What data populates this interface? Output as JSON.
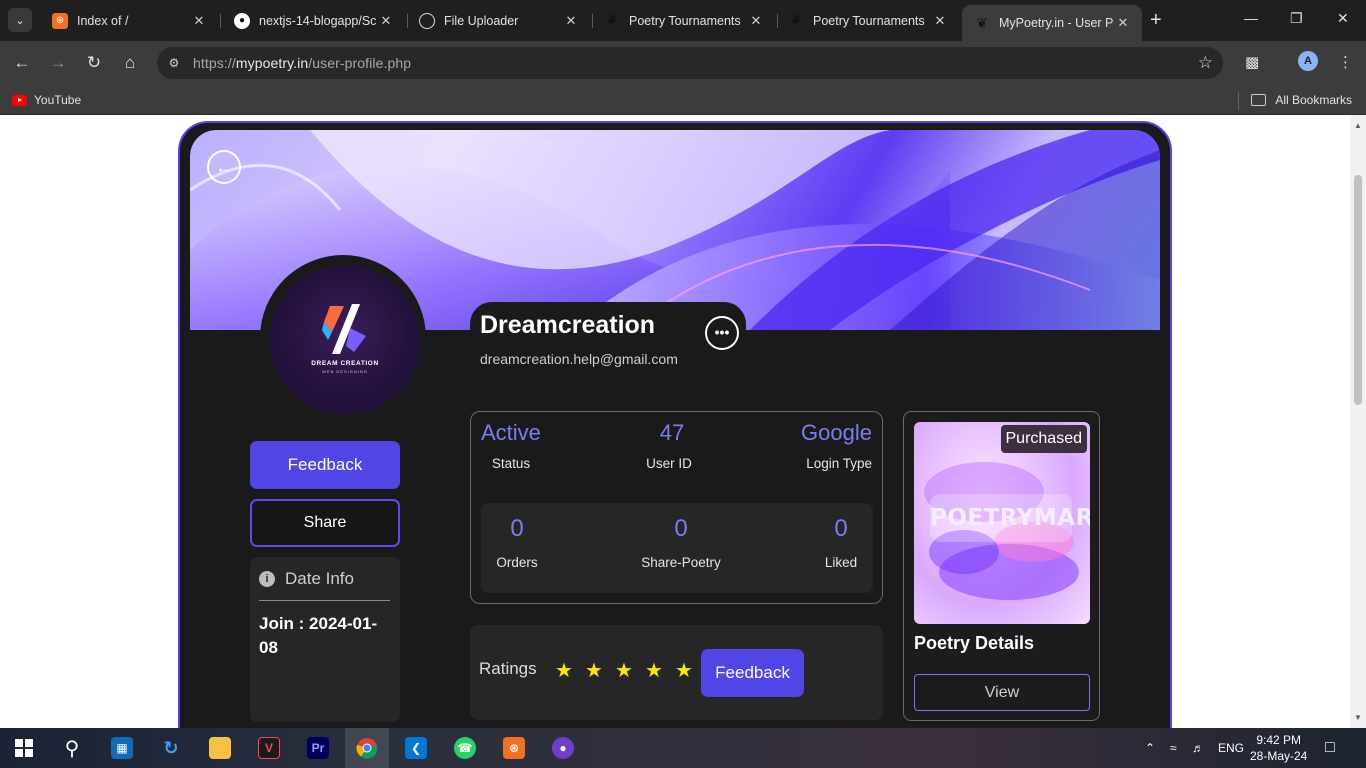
{
  "browser": {
    "tabs": [
      {
        "title": "Index of /",
        "icon": "xampp-icon",
        "active": false
      },
      {
        "title": "nextjs-14-blogapp/Sc",
        "icon": "github-icon",
        "active": false
      },
      {
        "title": "File Uploader",
        "icon": "globe-icon",
        "active": false
      },
      {
        "title": "Poetry Tournaments",
        "icon": "feather-icon",
        "active": false
      },
      {
        "title": "Poetry Tournaments",
        "icon": "feather-icon",
        "active": false
      },
      {
        "title": "MyPoetry.in - User Pr",
        "icon": "feather-icon",
        "active": true
      }
    ],
    "url_scheme": "https://",
    "url_host": "mypoetry.in",
    "url_path": "/user-profile.php",
    "bookmarks": [
      {
        "label": "YouTube",
        "icon": "youtube-icon"
      }
    ],
    "all_bookmarks_label": "All Bookmarks",
    "profile_initial": "A"
  },
  "profile": {
    "name": "Dreamcreation",
    "email": "dreamcreation.help@gmail.com",
    "logo_text": "DREAM CREATION",
    "logo_sub": "WEB DESIGNING",
    "more_icon": "more-horizontal-icon",
    "back_icon": "arrow-left-icon"
  },
  "actions": {
    "feedback_label": "Feedback",
    "share_label": "Share"
  },
  "date_info": {
    "heading": "Date Info",
    "join_text": "Join : 2024-01-08"
  },
  "stats": {
    "status": {
      "value": "Active",
      "label": "Status"
    },
    "user_id": {
      "value": "47",
      "label": "User ID"
    },
    "login_type": {
      "value": "Google",
      "label": "Login Type"
    },
    "orders": {
      "value": "0",
      "label": "Orders"
    },
    "share_poetry": {
      "value": "0",
      "label": "Share-Poetry"
    },
    "liked": {
      "value": "0",
      "label": "Liked"
    }
  },
  "ratings": {
    "label": "Ratings",
    "stars": 5,
    "star_max": 5,
    "button_label": "Feedback"
  },
  "product": {
    "badge": "Purchased",
    "brand": "POETRYMART",
    "title": "Poetry Details",
    "view_label": "View"
  },
  "taskbar": {
    "apps": [
      "windows-start-icon",
      "search-icon",
      "store-icon",
      "sync-icon",
      "file-explorer-icon",
      "valorant-icon",
      "premiere-icon",
      "chrome-icon",
      "vscode-icon",
      "whatsapp-icon",
      "xampp-icon",
      "github-desktop-icon"
    ],
    "language": "ENG",
    "time": "9:42 PM",
    "date": "28-May-24"
  },
  "colors": {
    "accent": "#4f46e5",
    "stat_value": "#7c7cf0",
    "card_bg": "#1a1a1a",
    "star": "#ffe500"
  }
}
